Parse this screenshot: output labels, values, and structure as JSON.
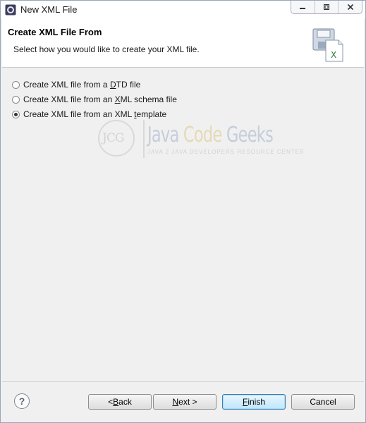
{
  "window": {
    "title": "New XML File",
    "controls": [
      "minimize",
      "restore",
      "close"
    ]
  },
  "header": {
    "title": "Create XML File From",
    "description": "Select how you would like to create your XML file.",
    "icon": "xml-file-save-icon"
  },
  "options": [
    {
      "pre": "Create XML file from a ",
      "mnemonic": "D",
      "post": "TD file",
      "checked": false
    },
    {
      "pre": "Create XML file from an ",
      "mnemonic": "X",
      "post": "ML schema file",
      "checked": false
    },
    {
      "pre": "Create XML file from an XML ",
      "mnemonic": "t",
      "post": "emplate",
      "checked": true
    }
  ],
  "watermark": {
    "logo_text": "JCG",
    "title_part1": "Java ",
    "title_part2": "Code",
    "title_part3": " Geeks",
    "subtitle": "JAVA 2 JAVA DEVELOPERS RESOURCE CENTER"
  },
  "footer": {
    "help": "?",
    "back": {
      "pre": "< ",
      "mnemonic": "B",
      "post": "ack"
    },
    "next": {
      "pre": "",
      "mnemonic": "N",
      "post": "ext >"
    },
    "finish": {
      "pre": "",
      "mnemonic": "F",
      "post": "inish"
    },
    "cancel": "Cancel"
  },
  "colors": {
    "default_button_border": "#3c7fb1",
    "watermark_blue": "#a3b3c9",
    "watermark_gold": "#dcc98a"
  }
}
